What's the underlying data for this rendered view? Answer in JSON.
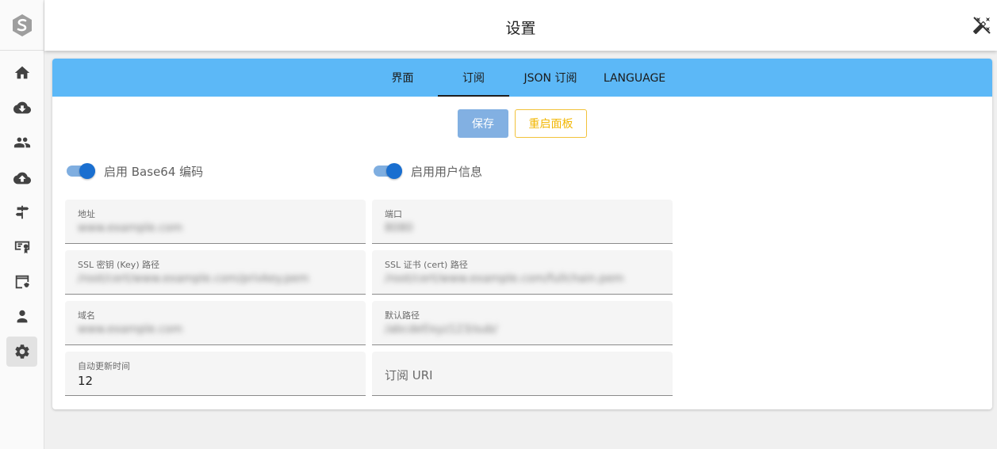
{
  "header": {
    "title": "设置",
    "theme_toggle_icon": "theme-toggle-icon"
  },
  "sidebar": {
    "logo_icon": "app-logo-icon",
    "items": [
      {
        "icon": "home-icon",
        "active": false
      },
      {
        "icon": "cloud-download-icon",
        "active": false
      },
      {
        "icon": "users-icon",
        "active": false
      },
      {
        "icon": "cloud-upload-icon",
        "active": false
      },
      {
        "icon": "signpost-icon",
        "active": false
      },
      {
        "icon": "certificate-icon",
        "active": false
      },
      {
        "icon": "web-settings-icon",
        "active": false
      },
      {
        "icon": "admin-icon",
        "active": false
      },
      {
        "icon": "settings-icon",
        "active": true
      }
    ]
  },
  "tabs": [
    {
      "label": "界面",
      "active": false
    },
    {
      "label": "订阅",
      "active": true
    },
    {
      "label": "JSON 订阅",
      "active": false
    },
    {
      "label": "LANGUAGE",
      "active": false
    }
  ],
  "actions": {
    "save_label": "保存",
    "restart_label": "重启面板"
  },
  "switches": [
    {
      "label": "启用 Base64 编码",
      "on": true
    },
    {
      "label": "启用用户信息",
      "on": true
    }
  ],
  "fields": {
    "address": {
      "label": "地址",
      "value": "www.example.com"
    },
    "port": {
      "label": "端口",
      "value": "8080"
    },
    "ssl_key": {
      "label": "SSL 密钥 (Key) 路径",
      "value": "/root/cert/www.example.com/privkey.pem"
    },
    "ssl_cert": {
      "label": "SSL 证书 (cert) 路径",
      "value": "/root/cert/www.example.com/fullchain.pem"
    },
    "domain": {
      "label": "域名",
      "value": "www.example.com"
    },
    "default_path": {
      "label": "默认路径",
      "value": "/abcdef/xyz123/sub/"
    },
    "update_interval": {
      "label": "自动更新时间",
      "value": "12"
    },
    "sub_uri": {
      "placeholder": "订阅 URI"
    }
  },
  "colors": {
    "tab_bar": "#5cb8f7",
    "primary": "#1a6fd0",
    "save_button": "#82b0e2",
    "warning": "#f2b705"
  }
}
